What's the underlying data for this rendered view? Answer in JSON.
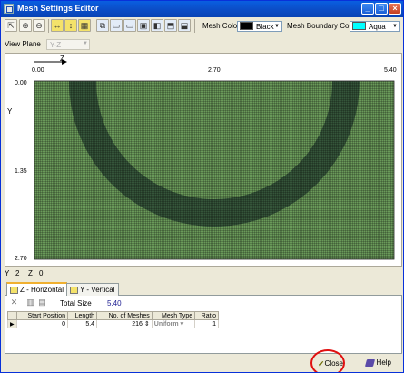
{
  "window": {
    "title": "Mesh Settings Editor"
  },
  "toolbar": {
    "mesh_color_label": "Mesh Color",
    "mesh_color_value": "Black",
    "mesh_color_swatch": "#000000",
    "boundary_color_label": "Mesh Boundary Color",
    "boundary_color_value": "Aqua",
    "boundary_color_swatch": "#00ffff"
  },
  "view_plane": {
    "label": "View Plane",
    "value": "Y-Z"
  },
  "canvas": {
    "horizontal_axis_label": "Z",
    "vertical_axis_label": "Y",
    "top_ticks": [
      "0.00",
      "2.70",
      "5.40"
    ],
    "left_ticks": [
      "0.00",
      "1.35",
      "2.70"
    ],
    "mesh_fill": "#6a9a5a"
  },
  "coordinates": {
    "y_label": "Y",
    "y_value": "2",
    "z_label": "Z",
    "z_value": "0"
  },
  "tabs": [
    {
      "label": "Z - Horizontal"
    },
    {
      "label": "Y - Vertical"
    }
  ],
  "pane": {
    "total_size_label": "Total Size",
    "total_size_value": "5.40",
    "columns": [
      "Start Position",
      "Length",
      "No. of Meshes",
      "Mesh Type",
      "Ratio"
    ],
    "rows": [
      {
        "start": "0",
        "length": "5.4",
        "meshes": "216",
        "type": "Uniform",
        "ratio": "1"
      }
    ]
  },
  "buttons": {
    "close": "Close",
    "help": "Help"
  }
}
